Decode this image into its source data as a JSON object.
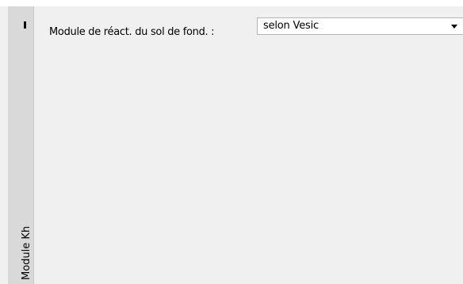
{
  "side_panel": {
    "label": "Module Kh"
  },
  "form": {
    "soil_modulus_label": "Module de réact. du sol de fond. :",
    "soil_modulus_select": {
      "value": "selon Vesic"
    }
  },
  "icons": {
    "dropdown": "chevron-down-icon"
  }
}
